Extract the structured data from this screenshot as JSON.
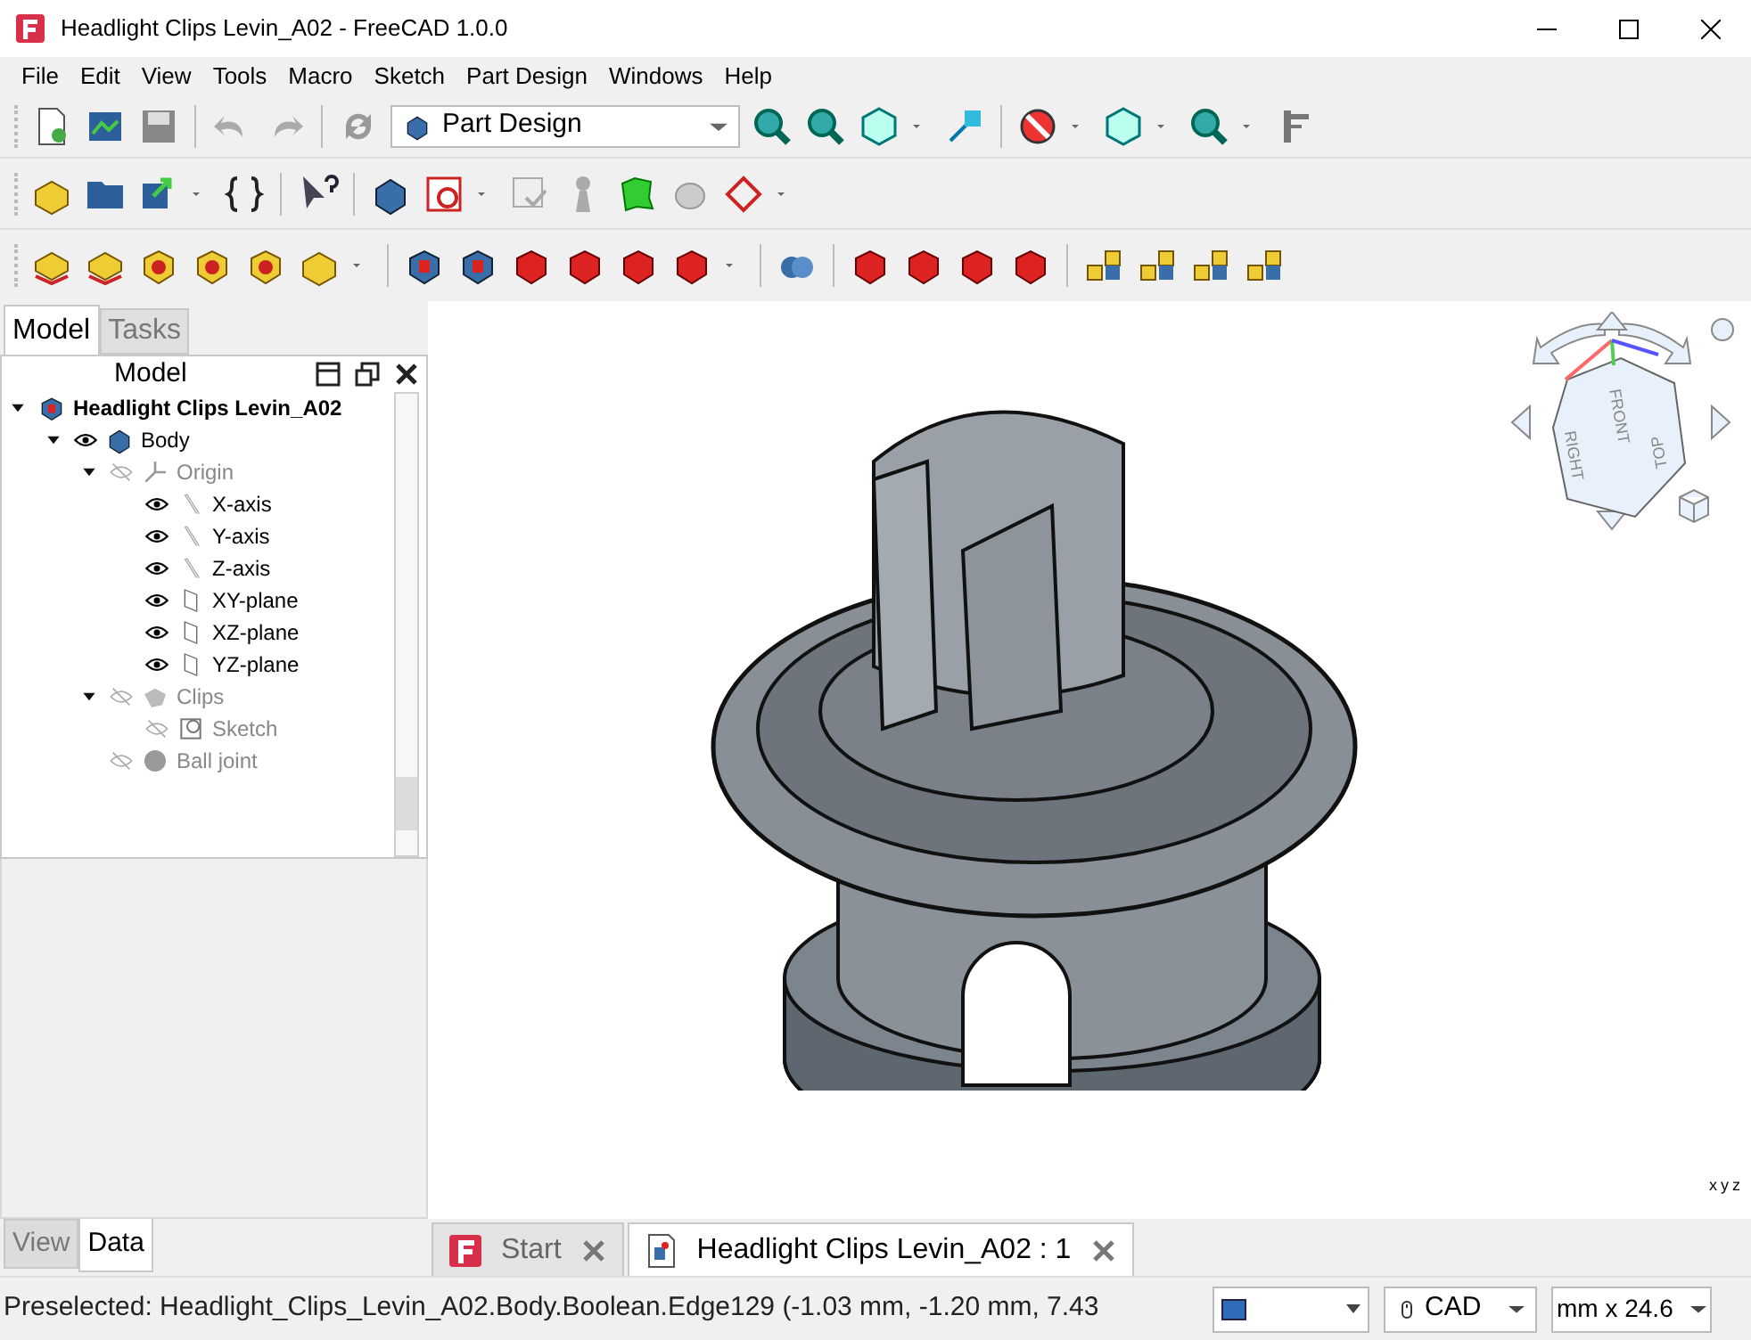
{
  "window": {
    "title": "Headlight Clips Levin_A02 - FreeCAD 1.0.0"
  },
  "menu": [
    "File",
    "Edit",
    "View",
    "Tools",
    "Macro",
    "Sketch",
    "Part Design",
    "Windows",
    "Help"
  ],
  "workbench": {
    "value": "Part Design"
  },
  "panel_tabs": [
    {
      "label": "Model",
      "selected": true
    },
    {
      "label": "Tasks",
      "selected": false
    }
  ],
  "panel": {
    "title": "Model"
  },
  "tree": [
    {
      "label": "Headlight Clips Levin_A02",
      "kind": "document",
      "expanded": true,
      "children": [
        {
          "label": "Body",
          "kind": "body",
          "visible": true,
          "expanded": true,
          "children": [
            {
              "label": "Origin",
              "kind": "origin",
              "visible": false,
              "expanded": true,
              "children": [
                {
                  "label": "X-axis",
                  "kind": "axis",
                  "visible": true
                },
                {
                  "label": "Y-axis",
                  "kind": "axis",
                  "visible": true
                },
                {
                  "label": "Z-axis",
                  "kind": "axis",
                  "visible": true
                },
                {
                  "label": "XY-plane",
                  "kind": "plane",
                  "visible": true
                },
                {
                  "label": "XZ-plane",
                  "kind": "plane",
                  "visible": true
                },
                {
                  "label": "YZ-plane",
                  "kind": "plane",
                  "visible": true
                }
              ]
            },
            {
              "label": "Clips",
              "kind": "feature",
              "visible": false,
              "expanded": true,
              "children": [
                {
                  "label": "Sketch",
                  "kind": "sketch",
                  "visible": false
                }
              ]
            },
            {
              "label": "Ball joint",
              "kind": "sphere",
              "visible": false
            }
          ]
        }
      ]
    }
  ],
  "property_tabs": [
    {
      "label": "View",
      "selected": false
    },
    {
      "label": "Data",
      "selected": true
    }
  ],
  "doc_tabs": [
    {
      "label": "Start",
      "kind": "start",
      "selected": false
    },
    {
      "label": "Headlight Clips Levin_A02 : 1",
      "kind": "document",
      "selected": true
    }
  ],
  "navcube": {
    "faces": [
      "FRONT",
      "TOP",
      "RIGHT"
    ]
  },
  "axis_labels": [
    "x",
    "y",
    "z"
  ],
  "status_bar": {
    "text": "Preselected: Headlight_Clips_Levin_A02.Body.Boolean.Edge129 (-1.03 mm, -1.20 mm, 7.43",
    "navigation": "CAD",
    "units": "mm x 24.6"
  }
}
